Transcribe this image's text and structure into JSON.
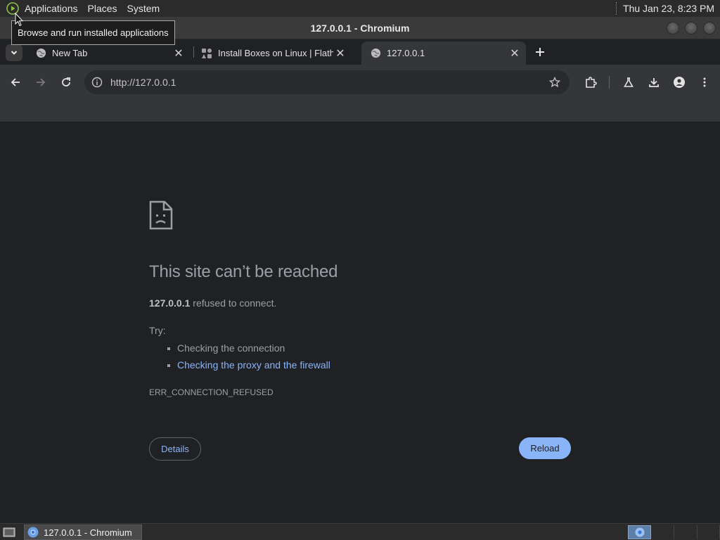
{
  "top_panel": {
    "menus": [
      "Applications",
      "Places",
      "System"
    ],
    "clock": "Thu Jan 23,  8:23 PM"
  },
  "tooltip": "Browse and run installed applications",
  "window": {
    "title": "127.0.0.1 - Chromium"
  },
  "tabs": [
    {
      "label": "New Tab",
      "icon": "globe-icon",
      "active": false
    },
    {
      "label": "Install Boxes on Linux | Flathub",
      "icon": "flathub-icon",
      "active": false
    },
    {
      "label": "127.0.0.1",
      "icon": "globe-icon",
      "active": true
    }
  ],
  "toolbar": {
    "url": "http://127.0.0.1"
  },
  "error_page": {
    "title": "This site can’t be reached",
    "host": "127.0.0.1",
    "summary_rest": " refused to connect.",
    "try_label": "Try:",
    "suggestions": [
      {
        "text": "Checking the connection",
        "link": false
      },
      {
        "text": "Checking the proxy and the firewall",
        "link": true
      }
    ],
    "error_code": "ERR_CONNECTION_REFUSED",
    "details_label": "Details",
    "reload_label": "Reload"
  },
  "taskbar": {
    "window_button": "127.0.0.1 - Chromium"
  },
  "colors": {
    "page_bg": "#202124",
    "link": "#8ab4f8",
    "reload_bg": "#8ab4f8",
    "text_muted": "#9aa0a6",
    "toolbar_bg": "#35363a"
  }
}
